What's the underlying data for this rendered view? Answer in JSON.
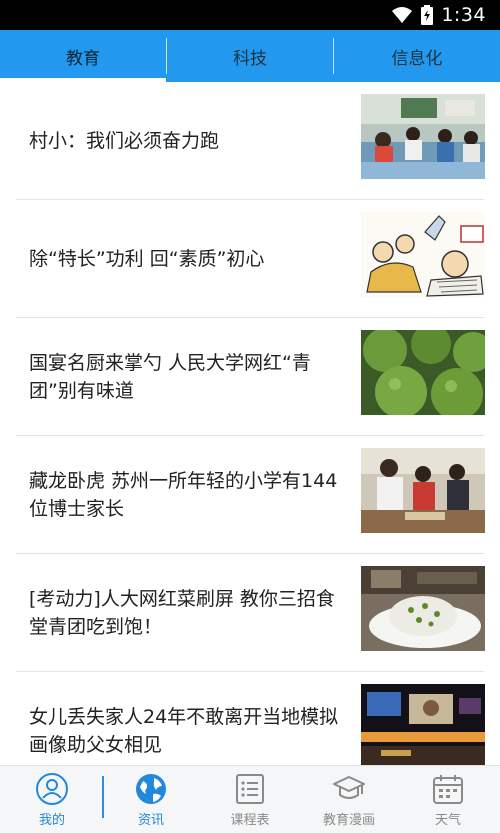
{
  "status_bar": {
    "time": "1:34",
    "icons": [
      "wifi-icon",
      "battery-icon"
    ]
  },
  "tabs": [
    {
      "label": "教育",
      "active": true
    },
    {
      "label": "科技",
      "active": false
    },
    {
      "label": "信息化",
      "active": false
    }
  ],
  "news": [
    {
      "title": "村小：我们必须奋力跑",
      "image": "classroom-students-photo"
    },
    {
      "title": "除“特长”功利 回“素质”初心",
      "image": "cartoon-illustration"
    },
    {
      "title": "国宴名厨来掌勺 人民大学网红“青团”别有味道",
      "image": "green-dumplings-photo"
    },
    {
      "title": "藏龙卧虎 苏州一所年轻的小学有144位博士家长",
      "image": "school-activity-photo"
    },
    {
      "title": "[考动力]人大网红菜刷屏 教你三招食堂青团吃到饱！",
      "image": "canteen-dish-photo"
    },
    {
      "title": "女儿丢失家人24年不敢离开当地模拟画像助父女相见",
      "image": "news-screen-photo"
    }
  ],
  "bottom_nav": [
    {
      "label": "我的",
      "icon": "user-icon",
      "active": true
    },
    {
      "label": "资讯",
      "icon": "globe-icon",
      "active": true
    },
    {
      "label": "课程表",
      "icon": "list-icon",
      "active": false
    },
    {
      "label": "教育漫画",
      "icon": "graduation-cap-icon",
      "active": false
    },
    {
      "label": "天气",
      "icon": "calendar-icon",
      "active": false
    }
  ],
  "colors": {
    "primary": "#2299ee",
    "nav_active": "#2288dd",
    "nav_inactive": "#8a8a8a"
  }
}
